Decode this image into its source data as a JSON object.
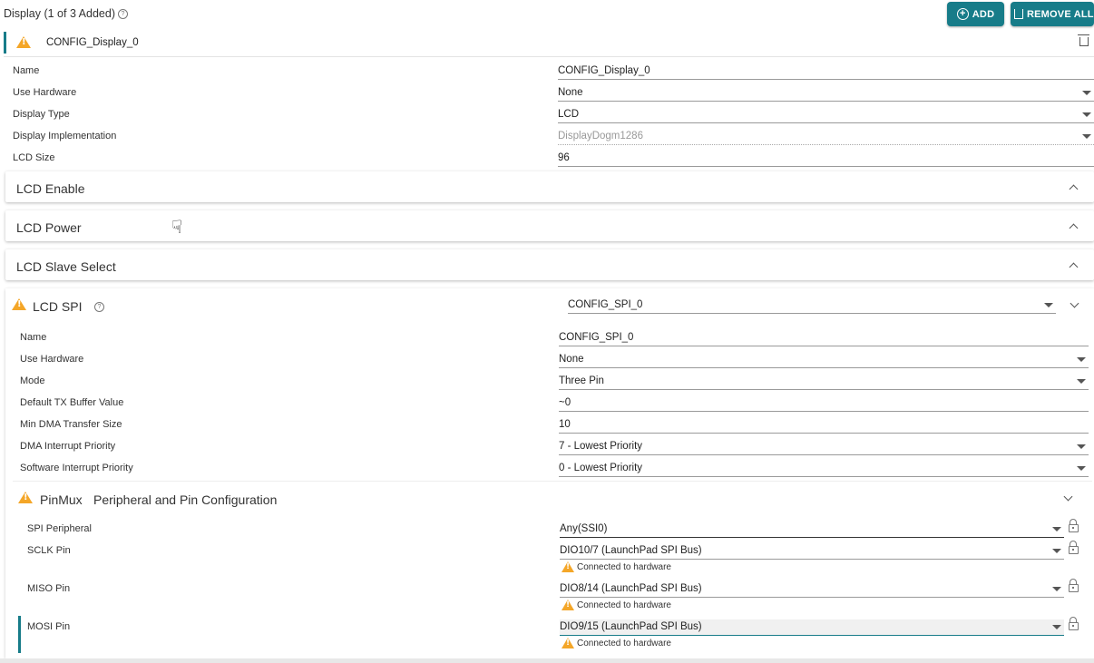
{
  "header": {
    "title": "Display (1 of 3 Added)",
    "add_label": "ADD",
    "remove_all_label": "REMOVE ALL"
  },
  "config": {
    "name": "CONFIG_Display_0"
  },
  "display_fields": [
    {
      "label": "Name",
      "value": "CONFIG_Display_0"
    },
    {
      "label": "Use Hardware",
      "value": "None"
    },
    {
      "label": "Display Type",
      "value": "LCD"
    },
    {
      "label": "Display Implementation",
      "value": "DisplayDogm1286"
    },
    {
      "label": "LCD Size",
      "value": "96"
    }
  ],
  "sections": [
    "LCD Enable",
    "LCD Power",
    "LCD Slave Select"
  ],
  "lcd_spi": {
    "title": "LCD SPI",
    "selected": "CONFIG_SPI_0",
    "fields": [
      {
        "label": "Name",
        "value": "CONFIG_SPI_0"
      },
      {
        "label": "Use Hardware",
        "value": "None"
      },
      {
        "label": "Mode",
        "value": "Three Pin"
      },
      {
        "label": "Default TX Buffer Value",
        "value": "~0"
      },
      {
        "label": "Min DMA Transfer Size",
        "value": "10"
      },
      {
        "label": "DMA Interrupt Priority",
        "value": "7 - Lowest Priority"
      },
      {
        "label": "Software Interrupt Priority",
        "value": "0 - Lowest Priority"
      }
    ]
  },
  "pinmux": {
    "title": "PinMux",
    "subtitle": "Peripheral and Pin Configuration",
    "fields": [
      {
        "label": "SPI Peripheral",
        "value": "Any(SSI0)"
      },
      {
        "label": "SCLK Pin",
        "value": "DIO10/7 (LaunchPad SPI Bus)",
        "note": "Connected to hardware"
      },
      {
        "label": "MISO Pin",
        "value": "DIO8/14 (LaunchPad SPI Bus)",
        "note": "Connected to hardware"
      },
      {
        "label": "MOSI Pin",
        "value": "DIO9/15 (LaunchPad SPI Bus)",
        "note": "Connected to hardware"
      }
    ]
  },
  "colors": {
    "accent": "#177c89",
    "warning": "#f4a628"
  }
}
